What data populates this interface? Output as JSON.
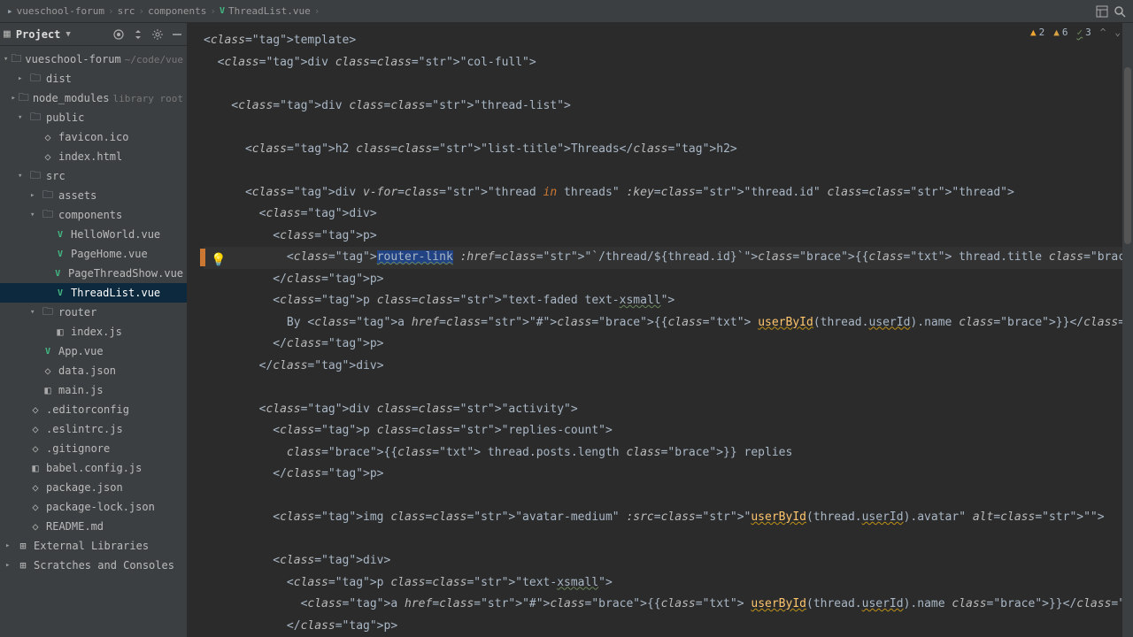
{
  "breadcrumb": [
    "vueschool-forum",
    "src",
    "components",
    "ThreadList.vue"
  ],
  "project": {
    "label": "Project"
  },
  "inspections": {
    "warn_tri": "2",
    "warn": "6",
    "typo": "3"
  },
  "tree": [
    {
      "depth": 0,
      "chev": "▾",
      "icon": "folder",
      "label": "vueschool-forum",
      "sec": "~/code/vue"
    },
    {
      "depth": 1,
      "chev": "▸",
      "icon": "folder",
      "label": "dist"
    },
    {
      "depth": 1,
      "chev": "▸",
      "icon": "folder",
      "label": "node_modules",
      "sec": "library root"
    },
    {
      "depth": 1,
      "chev": "▾",
      "icon": "folder",
      "label": "public"
    },
    {
      "depth": 2,
      "chev": "",
      "icon": "file",
      "label": "favicon.ico"
    },
    {
      "depth": 2,
      "chev": "",
      "icon": "file",
      "label": "index.html"
    },
    {
      "depth": 1,
      "chev": "▾",
      "icon": "folder",
      "label": "src"
    },
    {
      "depth": 2,
      "chev": "▸",
      "icon": "folder",
      "label": "assets"
    },
    {
      "depth": 2,
      "chev": "▾",
      "icon": "folder",
      "label": "components"
    },
    {
      "depth": 3,
      "chev": "",
      "icon": "vue",
      "label": "HelloWorld.vue"
    },
    {
      "depth": 3,
      "chev": "",
      "icon": "vue",
      "label": "PageHome.vue"
    },
    {
      "depth": 3,
      "chev": "",
      "icon": "vue",
      "label": "PageThreadShow.vue"
    },
    {
      "depth": 3,
      "chev": "",
      "icon": "vue",
      "label": "ThreadList.vue",
      "selected": true
    },
    {
      "depth": 2,
      "chev": "▾",
      "icon": "folder",
      "label": "router"
    },
    {
      "depth": 3,
      "chev": "",
      "icon": "js",
      "label": "index.js"
    },
    {
      "depth": 2,
      "chev": "",
      "icon": "vue",
      "label": "App.vue"
    },
    {
      "depth": 2,
      "chev": "",
      "icon": "file",
      "label": "data.json"
    },
    {
      "depth": 2,
      "chev": "",
      "icon": "js",
      "label": "main.js"
    },
    {
      "depth": 1,
      "chev": "",
      "icon": "file",
      "label": ".editorconfig"
    },
    {
      "depth": 1,
      "chev": "",
      "icon": "file",
      "label": ".eslintrc.js"
    },
    {
      "depth": 1,
      "chev": "",
      "icon": "file",
      "label": ".gitignore"
    },
    {
      "depth": 1,
      "chev": "",
      "icon": "js",
      "label": "babel.config.js"
    },
    {
      "depth": 1,
      "chev": "",
      "icon": "file",
      "label": "package.json"
    },
    {
      "depth": 1,
      "chev": "",
      "icon": "file",
      "label": "package-lock.json"
    },
    {
      "depth": 1,
      "chev": "",
      "icon": "file",
      "label": "README.md"
    },
    {
      "depth": 0,
      "chev": "▸",
      "icon": "lib",
      "label": "External Libraries"
    },
    {
      "depth": 0,
      "chev": "▸",
      "icon": "lib",
      "label": "Scratches and Consoles"
    }
  ],
  "code": {
    "lines": [
      {
        "t": "<template>"
      },
      {
        "t": "  <div class=\"col-full\">"
      },
      {
        "t": ""
      },
      {
        "t": "    <div class=\"thread-list\">"
      },
      {
        "t": ""
      },
      {
        "t": "      <h2 class=\"list-title\">Threads</h2>"
      },
      {
        "t": ""
      },
      {
        "t": "      <div v-for=\"thread in threads\" :key=\"thread.id\" class=\"thread\">"
      },
      {
        "t": "        <div>"
      },
      {
        "t": "          <p>"
      },
      {
        "t": "            <router-link :href=\"`/thread/${thread.id}`\">{{ thread.title }}</router-link>",
        "current": true
      },
      {
        "t": "          </p>"
      },
      {
        "t": "          <p class=\"text-faded text-xsmall\">"
      },
      {
        "t": "            By <a href=\"#\">{{ userById(thread.userId).name }}</a>, {{ thread.publishedAt }}."
      },
      {
        "t": "          </p>"
      },
      {
        "t": "        </div>"
      },
      {
        "t": ""
      },
      {
        "t": "        <div class=\"activity\">"
      },
      {
        "t": "          <p class=\"replies-count\">"
      },
      {
        "t": "            {{ thread.posts.length }} replies"
      },
      {
        "t": "          </p>"
      },
      {
        "t": ""
      },
      {
        "t": "          <img class=\"avatar-medium\" :src=\"userById(thread.userId).avatar\" alt=\"\">"
      },
      {
        "t": ""
      },
      {
        "t": "          <div>"
      },
      {
        "t": "            <p class=\"text-xsmall\">"
      },
      {
        "t": "              <a href=\"#\">{{ userById(thread.userId).name }}</a>"
      },
      {
        "t": "            </p>"
      }
    ]
  }
}
